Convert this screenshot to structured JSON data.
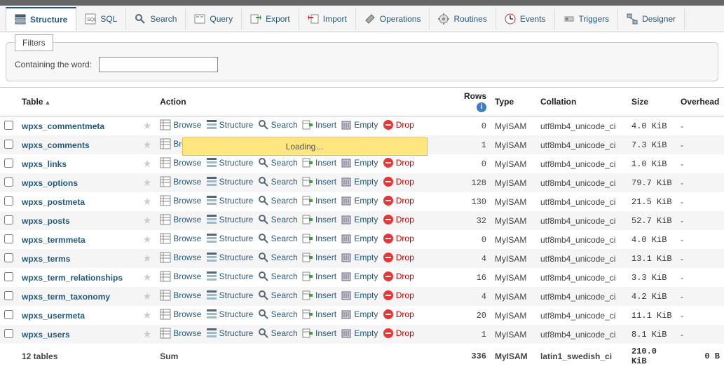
{
  "tabs": [
    {
      "label": "Structure"
    },
    {
      "label": "SQL"
    },
    {
      "label": "Search"
    },
    {
      "label": "Query"
    },
    {
      "label": "Export"
    },
    {
      "label": "Import"
    },
    {
      "label": "Operations"
    },
    {
      "label": "Routines"
    },
    {
      "label": "Events"
    },
    {
      "label": "Triggers"
    },
    {
      "label": "Designer"
    }
  ],
  "filters": {
    "legend": "Filters",
    "label": "Containing the word:",
    "value": ""
  },
  "headers": {
    "table": "Table",
    "action": "Action",
    "rows": "Rows",
    "type": "Type",
    "collation": "Collation",
    "size": "Size",
    "overhead": "Overhead"
  },
  "actions": {
    "browse": "Browse",
    "structure": "Structure",
    "search": "Search",
    "insert": "Insert",
    "empty": "Empty",
    "drop": "Drop"
  },
  "loading": "Loading…",
  "rows": [
    {
      "name": "wpxs_commentmeta",
      "rows": "0",
      "type": "MyISAM",
      "coll": "utf8mb4_unicode_ci",
      "size": "4.0 KiB",
      "over": "-"
    },
    {
      "name": "wpxs_comments",
      "rows": "1",
      "type": "MyISAM",
      "coll": "utf8mb4_unicode_ci",
      "size": "7.3 KiB",
      "over": "-"
    },
    {
      "name": "wpxs_links",
      "rows": "0",
      "type": "MyISAM",
      "coll": "utf8mb4_unicode_ci",
      "size": "1.0 KiB",
      "over": "-"
    },
    {
      "name": "wpxs_options",
      "rows": "128",
      "type": "MyISAM",
      "coll": "utf8mb4_unicode_ci",
      "size": "79.7 KiB",
      "over": "-"
    },
    {
      "name": "wpxs_postmeta",
      "rows": "130",
      "type": "MyISAM",
      "coll": "utf8mb4_unicode_ci",
      "size": "21.5 KiB",
      "over": "-"
    },
    {
      "name": "wpxs_posts",
      "rows": "32",
      "type": "MyISAM",
      "coll": "utf8mb4_unicode_ci",
      "size": "52.7 KiB",
      "over": "-"
    },
    {
      "name": "wpxs_termmeta",
      "rows": "0",
      "type": "MyISAM",
      "coll": "utf8mb4_unicode_ci",
      "size": "4.0 KiB",
      "over": "-"
    },
    {
      "name": "wpxs_terms",
      "rows": "4",
      "type": "MyISAM",
      "coll": "utf8mb4_unicode_ci",
      "size": "13.1 KiB",
      "over": "-"
    },
    {
      "name": "wpxs_term_relationships",
      "rows": "16",
      "type": "MyISAM",
      "coll": "utf8mb4_unicode_ci",
      "size": "3.3 KiB",
      "over": "-"
    },
    {
      "name": "wpxs_term_taxonomy",
      "rows": "4",
      "type": "MyISAM",
      "coll": "utf8mb4_unicode_ci",
      "size": "4.2 KiB",
      "over": "-"
    },
    {
      "name": "wpxs_usermeta",
      "rows": "20",
      "type": "MyISAM",
      "coll": "utf8mb4_unicode_ci",
      "size": "11.1 KiB",
      "over": "-"
    },
    {
      "name": "wpxs_users",
      "rows": "1",
      "type": "MyISAM",
      "coll": "utf8mb4_unicode_ci",
      "size": "8.1 KiB",
      "over": "-"
    }
  ],
  "sum": {
    "label": "12 tables",
    "sum": "Sum",
    "rows": "336",
    "type": "MyISAM",
    "coll": "latin1_swedish_ci",
    "size": "210.0 KiB",
    "over": "0 B"
  }
}
